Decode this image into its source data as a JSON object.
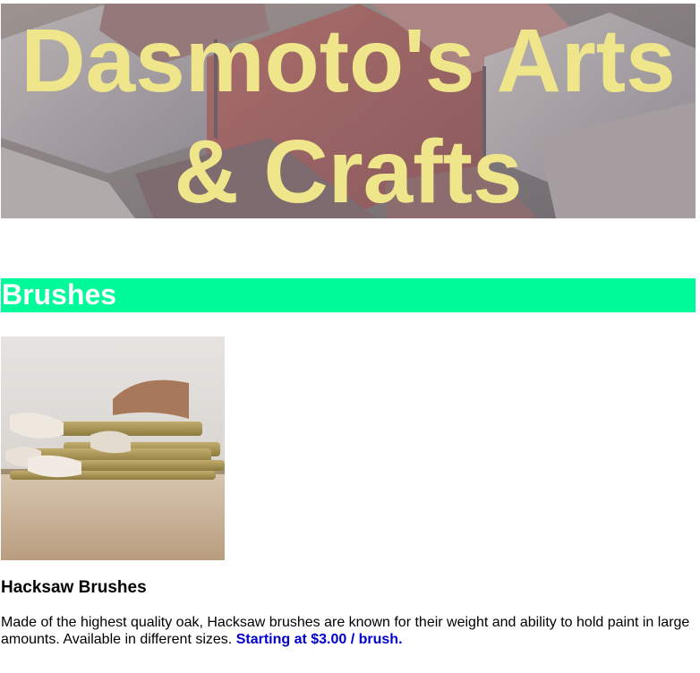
{
  "header": {
    "title": "Dasmoto's Arts & Crafts"
  },
  "section": {
    "title": "Brushes",
    "bar_color": "#00fa9a"
  },
  "product": {
    "image_icon": "paintbrush-photo-icon",
    "name": "Hacksaw Brushes",
    "description": "Made of the highest quality oak, Hacksaw brushes are known for their weight and ability to hold paint in large amounts. Available in different sizes.",
    "price": "Starting at $3.00 / brush.",
    "price_color": "#0000cd"
  },
  "colors": {
    "title_text": "#efe68b",
    "section_text": "#ffffff"
  }
}
